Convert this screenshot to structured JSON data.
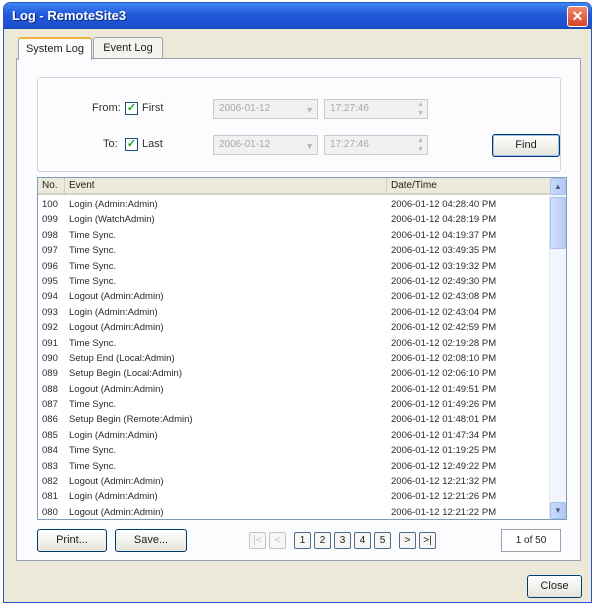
{
  "window": {
    "title": "Log - RemoteSite3"
  },
  "tabs": [
    {
      "label": "System Log",
      "active": true
    },
    {
      "label": "Event Log",
      "active": false
    }
  ],
  "filter": {
    "from_label": "From:",
    "to_label": "To:",
    "first_label": "First",
    "last_label": "Last",
    "first_checked": true,
    "last_checked": true,
    "from_date": "2006-01-12",
    "from_time": "17:27:46",
    "to_date": "2006-01-12",
    "to_time": "17:27:46",
    "find_label": "Find"
  },
  "table": {
    "headers": {
      "no": "No.",
      "event": "Event",
      "datetime": "Date/Time"
    },
    "rows": [
      {
        "no": "100",
        "event": "Login (Admin:Admin)",
        "datetime": "2006-01-12 04:28:40 PM"
      },
      {
        "no": "099",
        "event": "Login (WatchAdmin)",
        "datetime": "2006-01-12 04:28:19 PM"
      },
      {
        "no": "098",
        "event": "Time Sync.",
        "datetime": "2006-01-12 04:19:37 PM"
      },
      {
        "no": "097",
        "event": "Time Sync.",
        "datetime": "2006-01-12 03:49:35 PM"
      },
      {
        "no": "096",
        "event": "Time Sync.",
        "datetime": "2006-01-12 03:19:32 PM"
      },
      {
        "no": "095",
        "event": "Time Sync.",
        "datetime": "2006-01-12 02:49:30 PM"
      },
      {
        "no": "094",
        "event": "Logout (Admin:Admin)",
        "datetime": "2006-01-12 02:43:08 PM"
      },
      {
        "no": "093",
        "event": "Login (Admin:Admin)",
        "datetime": "2006-01-12 02:43:04 PM"
      },
      {
        "no": "092",
        "event": "Logout (Admin:Admin)",
        "datetime": "2006-01-12 02:42:59 PM"
      },
      {
        "no": "091",
        "event": "Time Sync.",
        "datetime": "2006-01-12 02:19:28 PM"
      },
      {
        "no": "090",
        "event": "Setup End (Local:Admin)",
        "datetime": "2006-01-12 02:08:10 PM"
      },
      {
        "no": "089",
        "event": "Setup Begin (Local:Admin)",
        "datetime": "2006-01-12 02:06:10 PM"
      },
      {
        "no": "088",
        "event": "Logout (Admin:Admin)",
        "datetime": "2006-01-12 01:49:51 PM"
      },
      {
        "no": "087",
        "event": "Time Sync.",
        "datetime": "2006-01-12 01:49:26 PM"
      },
      {
        "no": "086",
        "event": "Setup Begin (Remote:Admin)",
        "datetime": "2006-01-12 01:48:01 PM"
      },
      {
        "no": "085",
        "event": "Login (Admin:Admin)",
        "datetime": "2006-01-12 01:47:34 PM"
      },
      {
        "no": "084",
        "event": "Time Sync.",
        "datetime": "2006-01-12 01:19:25 PM"
      },
      {
        "no": "083",
        "event": "Time Sync.",
        "datetime": "2006-01-12 12:49:22 PM"
      },
      {
        "no": "082",
        "event": "Logout (Admin:Admin)",
        "datetime": "2006-01-12 12:21:32 PM"
      },
      {
        "no": "081",
        "event": "Login (Admin:Admin)",
        "datetime": "2006-01-12 12:21:26 PM"
      },
      {
        "no": "080",
        "event": "Logout (Admin:Admin)",
        "datetime": "2006-01-12 12:21:22 PM"
      }
    ]
  },
  "footer": {
    "print_label": "Print...",
    "save_label": "Save...",
    "page_buttons": [
      "1",
      "2",
      "3",
      "4",
      "5"
    ],
    "first_glyph": "|<",
    "prev_glyph": "<",
    "next_glyph": ">",
    "last_glyph": ">|",
    "page_indicator": "1 of 50",
    "close_label": "Close"
  }
}
